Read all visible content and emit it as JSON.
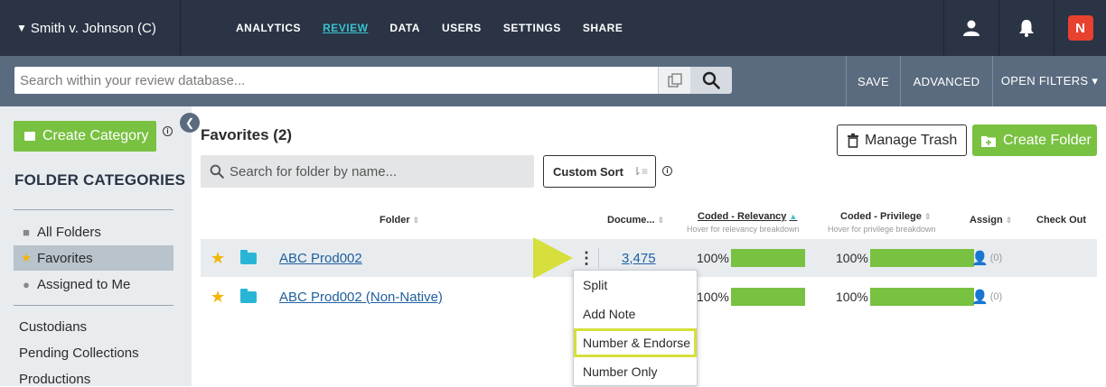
{
  "header": {
    "case_name": "Smith v. Johnson (C)",
    "nav": [
      {
        "label": "ANALYTICS",
        "active": false
      },
      {
        "label": "REVIEW",
        "active": true
      },
      {
        "label": "DATA",
        "active": false
      },
      {
        "label": "USERS",
        "active": false
      },
      {
        "label": "SETTINGS",
        "active": false
      },
      {
        "label": "SHARE",
        "active": false
      }
    ],
    "brand_letter": "N"
  },
  "search_bar": {
    "placeholder": "Search within your review database...",
    "save_label": "SAVE",
    "advanced_label": "ADVANCED",
    "open_filters_label": "OPEN FILTERS ▾"
  },
  "sidebar": {
    "create_category_label": "Create Category",
    "section_title": "FOLDER CATEGORIES",
    "items": [
      {
        "label": "All Folders",
        "icon": "folder-icon",
        "selected": false
      },
      {
        "label": "Favorites",
        "icon": "star-icon",
        "selected": true
      },
      {
        "label": "Assigned to Me",
        "icon": "person-icon",
        "selected": false
      }
    ],
    "links": [
      "Custodians",
      "Pending Collections",
      "Productions"
    ]
  },
  "main": {
    "title": "Favorites (2)",
    "folder_search_placeholder": "Search for folder by name...",
    "custom_sort_label": "Custom Sort",
    "manage_trash_label": "Manage Trash",
    "create_folder_label": "Create Folder",
    "columns": {
      "folder": "Folder",
      "documents": "Docume...",
      "relevancy": "Coded - Relevancy",
      "relevancy_hint": "Hover for relevancy breakdown",
      "privilege": "Coded - Privilege",
      "privilege_hint": "Hover for privilege breakdown",
      "assign": "Assign",
      "checkout": "Check Out"
    },
    "rows": [
      {
        "name": "ABC Prod002",
        "documents": "3,475",
        "relevancy": "100%",
        "privilege": "100%",
        "assign_count": "(0)"
      },
      {
        "name": "ABC Prod002 (Non-Native)",
        "documents": "",
        "relevancy": "100%",
        "privilege": "100%",
        "assign_count": "(0)"
      }
    ]
  },
  "context_menu": {
    "items": [
      "Split",
      "Add Note",
      "Number & Endorse",
      "Number Only"
    ],
    "highlighted": "Number & Endorse"
  },
  "colors": {
    "topbar": "#2a3444",
    "accent_green": "#79c141",
    "link_blue": "#1f5fa0",
    "active_nav": "#39c0cf",
    "highlight_yellow": "#d6df3c"
  }
}
